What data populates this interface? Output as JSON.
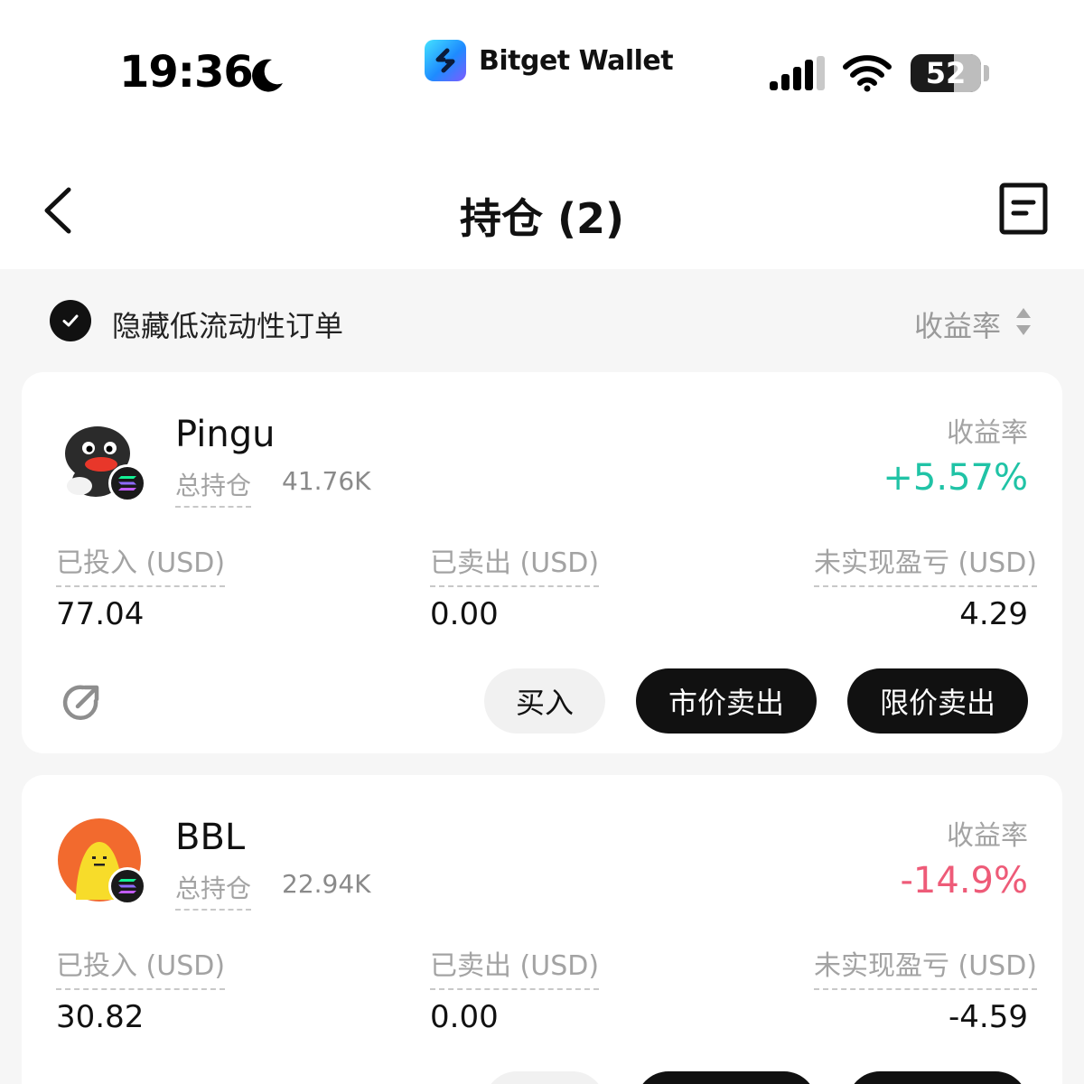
{
  "status_bar": {
    "time": "19:36",
    "battery": "52",
    "icons": [
      "moon-icon",
      "cellular-signal-icon",
      "wifi-icon",
      "battery-icon"
    ]
  },
  "brand": {
    "name": "Bitget Wallet"
  },
  "header": {
    "title": "持仓 (2)",
    "back_icon": "chevron-left-icon",
    "action_icon": "document-icon"
  },
  "filter": {
    "hide_low_liquidity_label": "隐藏低流动性订单",
    "hide_low_liquidity_checked": true,
    "sort_label": "收益率"
  },
  "colors": {
    "positive": "#20c3a6",
    "negative": "#ee5b78",
    "button_dark": "#111111"
  },
  "holdings": [
    {
      "name": "Pingu",
      "total_holding_label": "总持仓",
      "total_holding_value": "41.76K",
      "roi_label": "收益率",
      "roi_value": "+5.57%",
      "invested_label": "已投入 (USD)",
      "invested_value": "77.04",
      "sold_label": "已卖出 (USD)",
      "sold_value": "0.00",
      "unrealized_label": "未实现盈亏 (USD)",
      "unrealized_value": "4.29",
      "buy_label": "买入",
      "market_sell_label": "市价卖出",
      "limit_sell_label": "限价卖出"
    },
    {
      "name": "BBL",
      "total_holding_label": "总持仓",
      "total_holding_value": "22.94K",
      "roi_label": "收益率",
      "roi_value": "-14.9%",
      "invested_label": "已投入 (USD)",
      "invested_value": "30.82",
      "sold_label": "已卖出 (USD)",
      "sold_value": "0.00",
      "unrealized_label": "未实现盈亏 (USD)",
      "unrealized_value": "-4.59"
    }
  ]
}
